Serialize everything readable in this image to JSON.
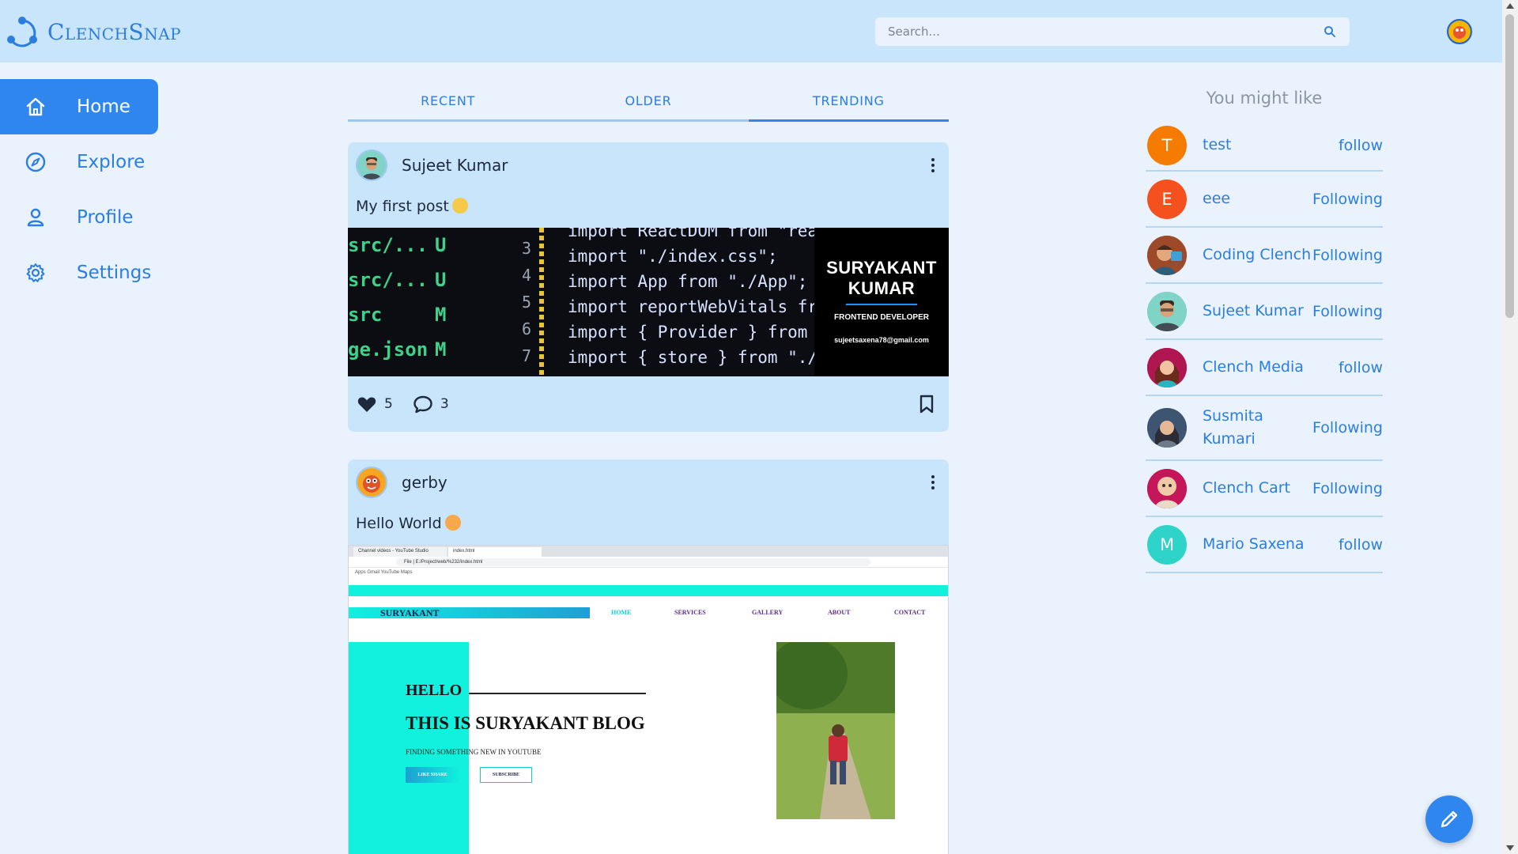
{
  "app": {
    "name": "ClenchSnap"
  },
  "search": {
    "placeholder": "Search..."
  },
  "sidebar": {
    "items": [
      {
        "label": "Home",
        "icon": "home-icon",
        "active": true
      },
      {
        "label": "Explore",
        "icon": "compass-icon",
        "active": false
      },
      {
        "label": "Profile",
        "icon": "user-icon",
        "active": false
      },
      {
        "label": "Settings",
        "icon": "gear-icon",
        "active": false
      }
    ]
  },
  "tabs": [
    {
      "label": "RECENT",
      "active": false
    },
    {
      "label": "OLDER",
      "active": false
    },
    {
      "label": "TRENDING",
      "active": true
    }
  ],
  "posts": [
    {
      "author": "Sujeet Kumar",
      "text": "My first post",
      "likes": "5",
      "comments": "3",
      "image": {
        "code_rows": [
          "src/...",
          "src/...",
          "src",
          "ge.json"
        ],
        "code_status": [
          "U",
          "U",
          "M",
          "M"
        ],
        "line_numbers": [
          "3",
          "4",
          "5",
          "6",
          "7"
        ],
        "code_lines": [
          "import ReactDOM from \"react-dom\"",
          "import \"./index.css\";",
          "import App from \"./App\";",
          "import reportWebVitals from \"./reportWebVitals\"",
          "import { Provider } from \"react-redux\"",
          "import { store } from \"./store\""
        ],
        "brand_name_1": "SURYAKANT",
        "brand_name_2": "KUMAR",
        "brand_role": "FRONTEND DEVELOPER",
        "brand_email": "sujeetsaxena78@gmail.com"
      }
    },
    {
      "author": "gerby",
      "text": "Hello World",
      "image": {
        "tab1": "Channel videos - YouTube Studio",
        "tab2": "index.html",
        "url": "File | E:/Project/web/%232/index.html",
        "bookmarks": "Apps   Gmail   YouTube   Maps",
        "site_brand": "SURYAKANT",
        "nav_links": [
          "HOME",
          "SERVICES",
          "GALLERY",
          "ABOUT",
          "CONTACT"
        ],
        "hello": "HELLO",
        "headline": "THIS IS SURYAKANT BLOG",
        "subline": "FINDING SOMETHING NEW IN YOUTUBE",
        "button1": "LIKE SHARE",
        "button2": "SUBSCRIBE"
      }
    }
  ],
  "suggestions": {
    "title": "You might like",
    "users": [
      {
        "initial": "T",
        "name": "test",
        "action": "follow",
        "color": "#f57c00"
      },
      {
        "initial": "E",
        "name": "eee",
        "action": "Following",
        "color": "#f4511e"
      },
      {
        "initial": "",
        "name": "Coding Clench",
        "action": "Following",
        "color": "#b5532d"
      },
      {
        "initial": "",
        "name": "Sujeet Kumar",
        "action": "Following",
        "color": "#5ec9c3"
      },
      {
        "initial": "",
        "name": "Clench Media",
        "action": "follow",
        "color": "#c2185b"
      },
      {
        "initial": "",
        "name": "Susmita Kumari",
        "action": "Following",
        "color": "#4b6584"
      },
      {
        "initial": "",
        "name": "Clench Cart",
        "action": "Following",
        "color": "#d81b60"
      },
      {
        "initial": "M",
        "name": "Mario Saxena",
        "action": "follow",
        "color": "#2ed3c9"
      }
    ]
  },
  "colors": {
    "accent": "#2f86ee",
    "header": "#c9e5fb",
    "background": "#eaf3fd",
    "link": "#2b7de0"
  }
}
